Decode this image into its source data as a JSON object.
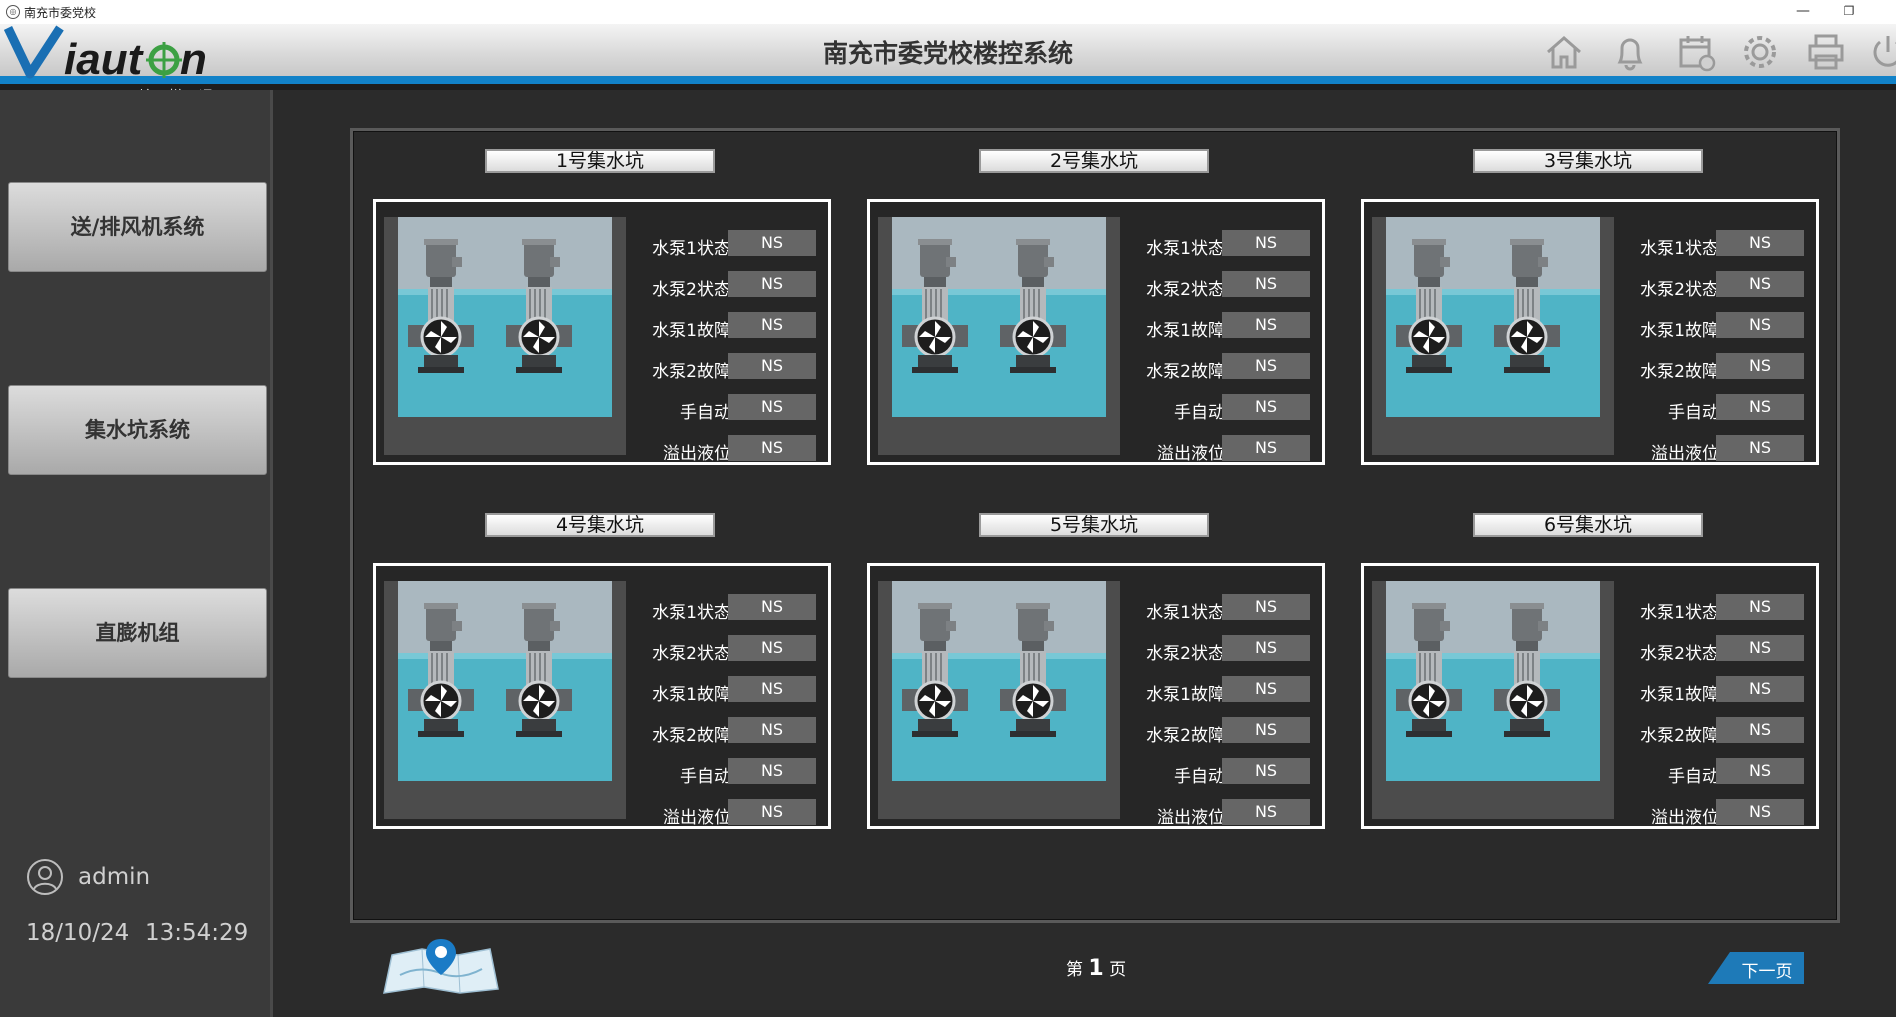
{
  "window": {
    "title": "南充市委党校",
    "minimize": "—",
    "restore": "❐",
    "close": "✕"
  },
  "header": {
    "title": "南充市委党校楼控系统",
    "logo_text": "Viauton",
    "logo_sub": "—翰 悦 通—"
  },
  "icons": [
    "home-icon",
    "bell-icon",
    "calendar-icon",
    "gear-icon",
    "printer-icon",
    "power-icon"
  ],
  "sidebar": {
    "items": [
      {
        "label": "送/排风机系统"
      },
      {
        "label": "集水坑系统"
      },
      {
        "label": "直膨机组"
      }
    ],
    "user": "admin",
    "date": "18/10/24",
    "time": "13:54:29"
  },
  "pits": [
    {
      "title": "1号集水坑",
      "rows": [
        {
          "label": "水泵1状态",
          "value": "NS"
        },
        {
          "label": "水泵2状态",
          "value": "NS"
        },
        {
          "label": "水泵1故障",
          "value": "NS"
        },
        {
          "label": "水泵2故障",
          "value": "NS"
        },
        {
          "label": "手自动",
          "value": "NS"
        },
        {
          "label": "溢出液位",
          "value": "NS"
        }
      ]
    },
    {
      "title": "2号集水坑",
      "rows": [
        {
          "label": "水泵1状态",
          "value": "NS"
        },
        {
          "label": "水泵2状态",
          "value": "NS"
        },
        {
          "label": "水泵1故障",
          "value": "NS"
        },
        {
          "label": "水泵2故障",
          "value": "NS"
        },
        {
          "label": "手自动",
          "value": "NS"
        },
        {
          "label": "溢出液位",
          "value": "NS"
        }
      ]
    },
    {
      "title": "3号集水坑",
      "rows": [
        {
          "label": "水泵1状态",
          "value": "NS"
        },
        {
          "label": "水泵2状态",
          "value": "NS"
        },
        {
          "label": "水泵1故障",
          "value": "NS"
        },
        {
          "label": "水泵2故障",
          "value": "NS"
        },
        {
          "label": "手自动",
          "value": "NS"
        },
        {
          "label": "溢出液位",
          "value": "NS"
        }
      ]
    },
    {
      "title": "4号集水坑",
      "rows": [
        {
          "label": "水泵1状态",
          "value": "NS"
        },
        {
          "label": "水泵2状态",
          "value": "NS"
        },
        {
          "label": "水泵1故障",
          "value": "NS"
        },
        {
          "label": "水泵2故障",
          "value": "NS"
        },
        {
          "label": "手自动",
          "value": "NS"
        },
        {
          "label": "溢出液位",
          "value": "NS"
        }
      ]
    },
    {
      "title": "5号集水坑",
      "rows": [
        {
          "label": "水泵1状态",
          "value": "NS"
        },
        {
          "label": "水泵2状态",
          "value": "NS"
        },
        {
          "label": "水泵1故障",
          "value": "NS"
        },
        {
          "label": "水泵2故障",
          "value": "NS"
        },
        {
          "label": "手自动",
          "value": "NS"
        },
        {
          "label": "溢出液位",
          "value": "NS"
        }
      ]
    },
    {
      "title": "6号集水坑",
      "rows": [
        {
          "label": "水泵1状态",
          "value": "NS"
        },
        {
          "label": "水泵2状态",
          "value": "NS"
        },
        {
          "label": "水泵1故障",
          "value": "NS"
        },
        {
          "label": "水泵2故障",
          "value": "NS"
        },
        {
          "label": "手自动",
          "value": "NS"
        },
        {
          "label": "溢出液位",
          "value": "NS"
        }
      ]
    }
  ],
  "footer": {
    "page_prefix": "第",
    "page_number": "1",
    "page_suffix": "页",
    "next_label": "下一页"
  },
  "colors": {
    "accent": "#1282c8",
    "water": "#4fb4c6",
    "value_bg": "#666666"
  }
}
